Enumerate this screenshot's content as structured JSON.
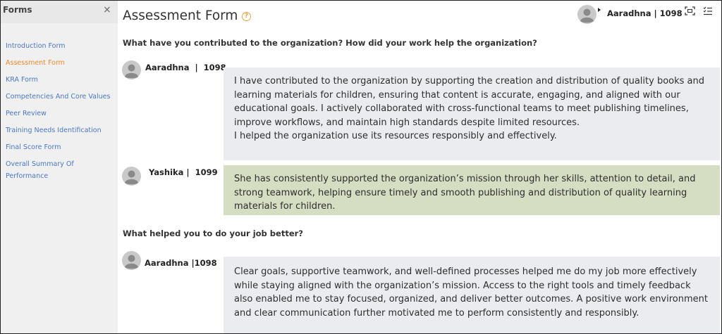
{
  "sidebar": {
    "title": "Forms",
    "close_glyph": "×",
    "items": [
      {
        "label": "Introduction Form",
        "active": false
      },
      {
        "label": "Assessment Form",
        "active": true
      },
      {
        "label": "KRA Form",
        "active": false
      },
      {
        "label": "Competencies And Core Values",
        "active": false
      },
      {
        "label": "Peer Review",
        "active": false
      },
      {
        "label": "Training Needs Identification",
        "active": false
      },
      {
        "label": "Final Score Form",
        "active": false
      },
      {
        "label": "Overall Summary Of Performance",
        "active": false
      }
    ]
  },
  "header": {
    "title": "Assessment Form",
    "help_glyph": "?",
    "user": "Aaradhna | 1098",
    "icons": [
      "avatar-icon",
      "caret-right-icon",
      "scan-icon",
      "checklist-icon"
    ]
  },
  "questions": [
    {
      "text": "What have you contributed to the organization? How did your work help the organization?",
      "responses": [
        {
          "author": "Aaradhna  |  1098",
          "style": "grey",
          "paragraphs": [
            "I have contributed to the organization by supporting the creation and distribution of quality books and learning materials for children, ensuring that content is accurate, engaging, and aligned with our educational goals. I actively collaborated with cross-functional teams to meet publishing timelines, improve workflows, and maintain high standards despite limited resources.",
            "I helped the organization use its resources responsibly and effectively."
          ]
        },
        {
          "author": "Yashika |  1099",
          "style": "green",
          "paragraphs": [
            "She has consistently supported the organization’s mission through her skills, attention to detail, and strong teamwork, helping ensure timely and smooth publishing and distribution of quality learning materials for children."
          ]
        }
      ]
    },
    {
      "text": "What helped you to do your job better?",
      "responses": [
        {
          "author": "Aaradhna |1098",
          "style": "grey",
          "paragraphs": [
            "Clear goals, supportive teamwork, and well-defined processes helped me do my job more effectively while staying aligned with the organization’s mission. Access to the right tools and timely feedback also enabled me to stay focused, organized, and deliver better outcomes. A positive work environment and clear communication further motivated me to perform consistently and responsibly."
          ]
        }
      ]
    }
  ],
  "colors": {
    "accent_orange": "#ef8a2b",
    "nav_link": "#4a78c6",
    "bubble_grey": "#ebecf0",
    "bubble_green": "#d5ddc3"
  }
}
